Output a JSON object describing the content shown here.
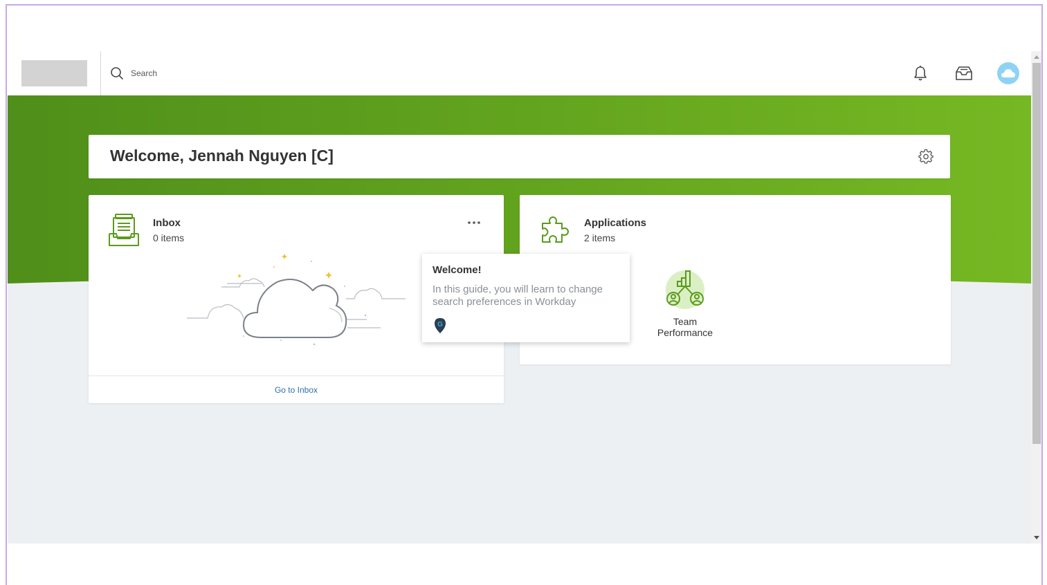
{
  "search": {
    "placeholder": "Search"
  },
  "welcome": {
    "title": "Welcome, Jennah Nguyen [C]"
  },
  "inbox": {
    "title": "Inbox",
    "count": "0 items",
    "link": "Go to Inbox"
  },
  "applications": {
    "title": "Applications",
    "count": "2 items",
    "apps": [
      {
        "label_line1": "Team",
        "label_line2": "Performance"
      }
    ]
  },
  "guide": {
    "title": "Welcome!",
    "body": "In this guide, you will learn to change search preferences in Workday"
  },
  "colors": {
    "brand_green": "#5a9a1c",
    "brand_green_light": "#7ab929",
    "link_blue": "#2f6fa6",
    "avatar_blue": "#8fd3f4",
    "background": "#edf0f3"
  },
  "icons": [
    "search-icon",
    "bell-icon",
    "inbox-tray-icon",
    "cloud-avatar-icon",
    "gear-icon",
    "inbox-document-icon",
    "more-dots-icon",
    "puzzle-icon",
    "team-performance-icon",
    "guide-pin-icon"
  ]
}
